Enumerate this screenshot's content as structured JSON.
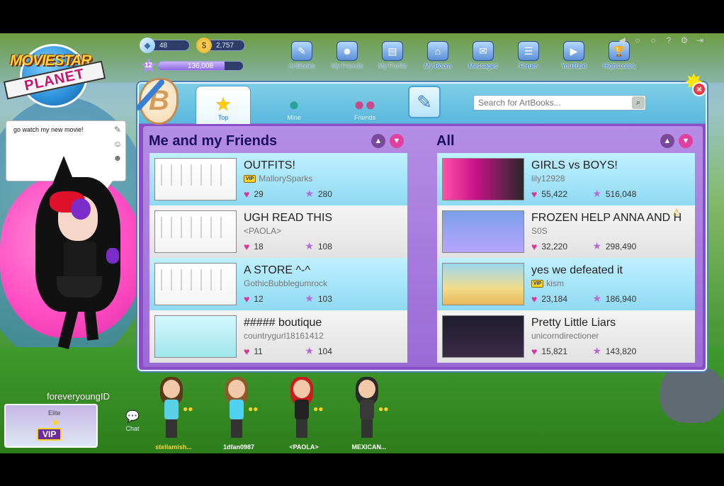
{
  "hud": {
    "diamonds": "48",
    "coins": "2,757",
    "level": "12",
    "fame": "136,008",
    "fame_progress": 0.78
  },
  "topnav": [
    {
      "label": "ArtBooks",
      "icon": "artbook-icon",
      "faded": true
    },
    {
      "label": "My Friends",
      "icon": "friends-icon",
      "faded": true
    },
    {
      "label": "My Profile",
      "icon": "profile-icon",
      "faded": true
    },
    {
      "label": "My Room",
      "icon": "house-icon",
      "faded": false
    },
    {
      "label": "Messages",
      "icon": "messages-icon",
      "faded": false
    },
    {
      "label": "Forum",
      "icon": "forum-icon",
      "faded": false
    },
    {
      "label": "YouTube",
      "icon": "youtube-icon",
      "faded": false
    },
    {
      "label": "Highscores",
      "icon": "trophy-icon",
      "faded": false
    }
  ],
  "logo": {
    "top": "MOVIESTAR",
    "bottom": "PLANET"
  },
  "chat_bubble": {
    "text": "go watch my new movie!"
  },
  "artbooks": {
    "tabs": {
      "top": "Top",
      "mine": "Mine",
      "friends": "Friends"
    },
    "search_placeholder": "Search for ArtBooks...",
    "friends_title": "Me and my Friends",
    "all_title": "All",
    "friends_items": [
      {
        "title": "OUTFITS!",
        "author": "MallorySparks",
        "vip": true,
        "likes": "29",
        "stars": "280",
        "thumb": "white"
      },
      {
        "title": "UGH READ THIS",
        "author": "<PAOLA>",
        "vip": false,
        "likes": "18",
        "stars": "108",
        "thumb": "white"
      },
      {
        "title": "A STORE ^-^",
        "author": "GothicBubblegumrock",
        "vip": false,
        "likes": "12",
        "stars": "103",
        "thumb": "white"
      },
      {
        "title": "##### boutique",
        "author": "countrygurl18161412",
        "vip": false,
        "likes": "11",
        "stars": "104",
        "thumb": "cyan"
      }
    ],
    "all_items": [
      {
        "title": "GIRLS vs BOYS!",
        "author": "lily12928",
        "vip": false,
        "likes": "55,422",
        "stars": "516,048",
        "thumb": "pink"
      },
      {
        "title": "FROZEN HELP ANNA AND H",
        "author": "S0S",
        "vip": false,
        "likes": "32,220",
        "stars": "298,490",
        "thumb": "purple",
        "warn": true
      },
      {
        "title": "yes we defeated it",
        "author": "kism",
        "vip": true,
        "likes": "23,184",
        "stars": "186,940",
        "thumb": "beach"
      },
      {
        "title": "Pretty Little Liars",
        "author": "unicorndirectioner",
        "vip": false,
        "likes": "15,821",
        "stars": "143,820",
        "thumb": "dark"
      }
    ],
    "vip_label": "VIP"
  },
  "player": {
    "username": "foreveryoungID",
    "card_elite": "Elite",
    "card_vip": "VIP"
  },
  "chat": {
    "label": "Chat"
  },
  "others": [
    {
      "name": "stellamish...",
      "hair": "#5a3a1a",
      "top": "#5ad0e8",
      "gold": true
    },
    {
      "name": "1dfan0987",
      "hair": "#8a5a2a",
      "top": "#4fd2f0",
      "gold": false
    },
    {
      "name": "<PAOLA>",
      "hair": "#c81e1e",
      "top": "#222222",
      "gold": false
    },
    {
      "name": "MEXICAN...",
      "hair": "#2a2a2a",
      "top": "#3a3a3a",
      "gold": false
    }
  ]
}
